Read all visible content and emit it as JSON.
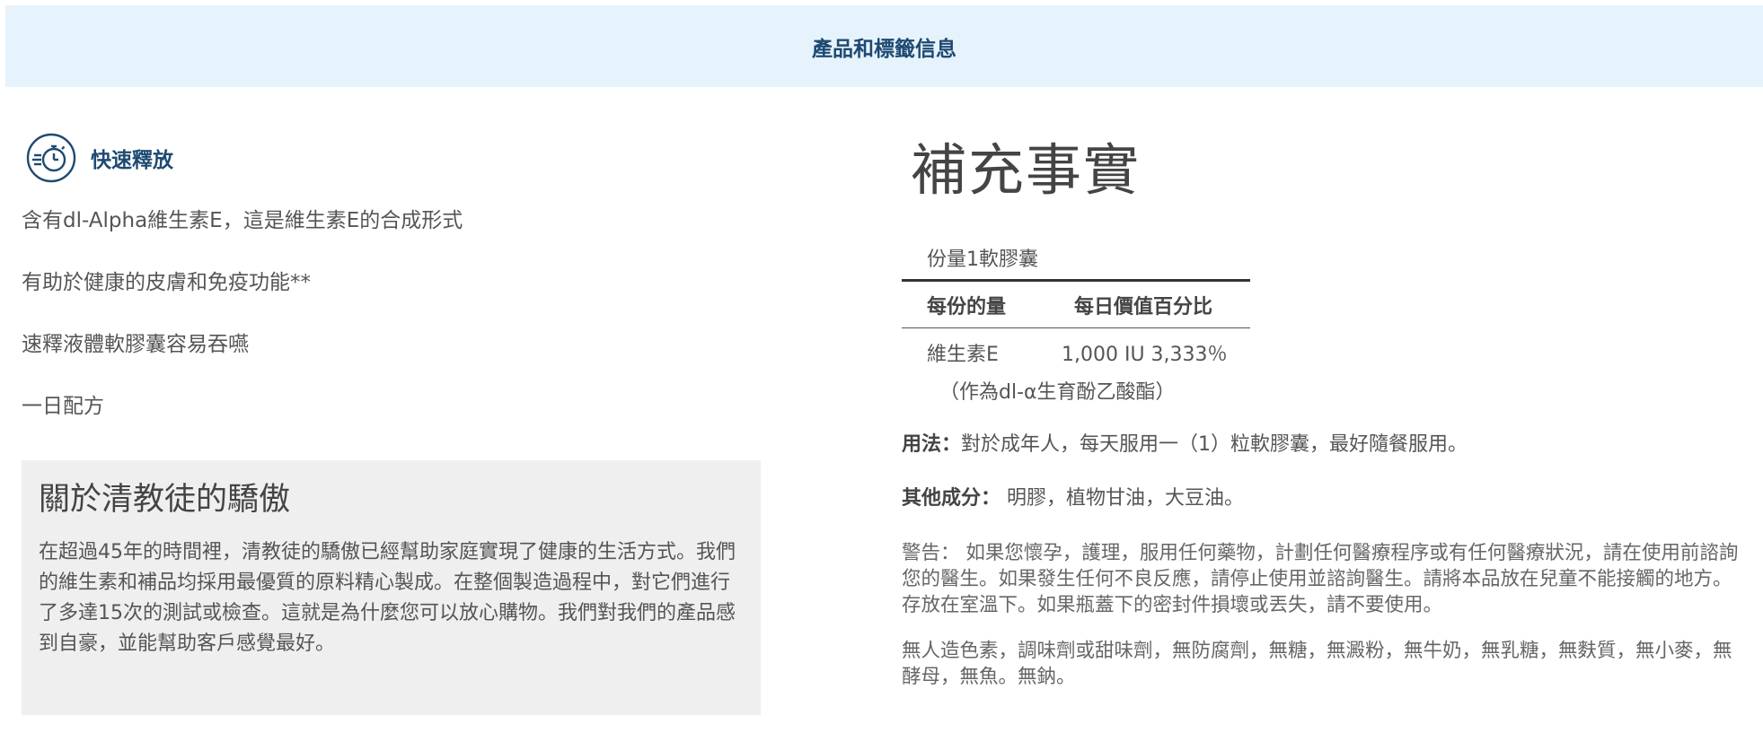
{
  "header": {
    "title": "產品和標籤信息"
  },
  "feature": {
    "icon": "stopwatch-icon",
    "title": "快速釋放"
  },
  "bullets": [
    "含有dl-Alpha維生素E，這是維生素E的合成形式",
    "有助於健康的皮膚和免疫功能**",
    "速釋液體軟膠囊容易吞嚥",
    "一日配方"
  ],
  "about": {
    "title": "關於清教徒的驕傲",
    "body": "在超過45年的時間裡，清教徒的驕傲已經幫助家庭實現了健康的生活方式。我們的維生素和補品均採用最優質的原料精心製成。在整個製造過程中，對它們進行了多達15次的測試或檢查。這就是為什麼您可以放心購物。我們對我們的產品感到自豪，並能幫助客戶感覺最好。"
  },
  "facts": {
    "title": "補充事實",
    "serving": "份量1軟膠囊",
    "col_amount": "每份的量",
    "col_dv": "每日價值百分比",
    "rows": [
      {
        "name": "維生素E",
        "value": "1,000 IU 3,333％"
      }
    ],
    "note": "（作為dl-α生育酚乙酸酯）"
  },
  "usage": {
    "label": "用法：",
    "text": "對於成年人，每天服用一（1）粒軟膠囊，最好隨餐服用。"
  },
  "other": {
    "label": "其他成分：",
    "text": " 明膠，植物甘油，大豆油。"
  },
  "warning": "警告： 如果您懷孕，護理，服用任何藥物，計劃任何醫療程序或有任何醫療狀況，請在使用前諮詢您的醫生。如果發生任何不良反應，請停止使用並諮詢醫生。請將本品放在兒童不能接觸的地方。存放在室溫下。如果瓶蓋下的密封件損壞或丟失，請不要使用。",
  "free_from": "無人造色素，調味劑或甜味劑，無防腐劑，無糖，無澱粉，無牛奶，無乳糖，無麩質，無小麥，無酵母，無魚。無鈉。",
  "colors": {
    "header_bg": "#e6f3fc",
    "brand_blue": "#1e4a72",
    "about_bg": "#efefef"
  }
}
